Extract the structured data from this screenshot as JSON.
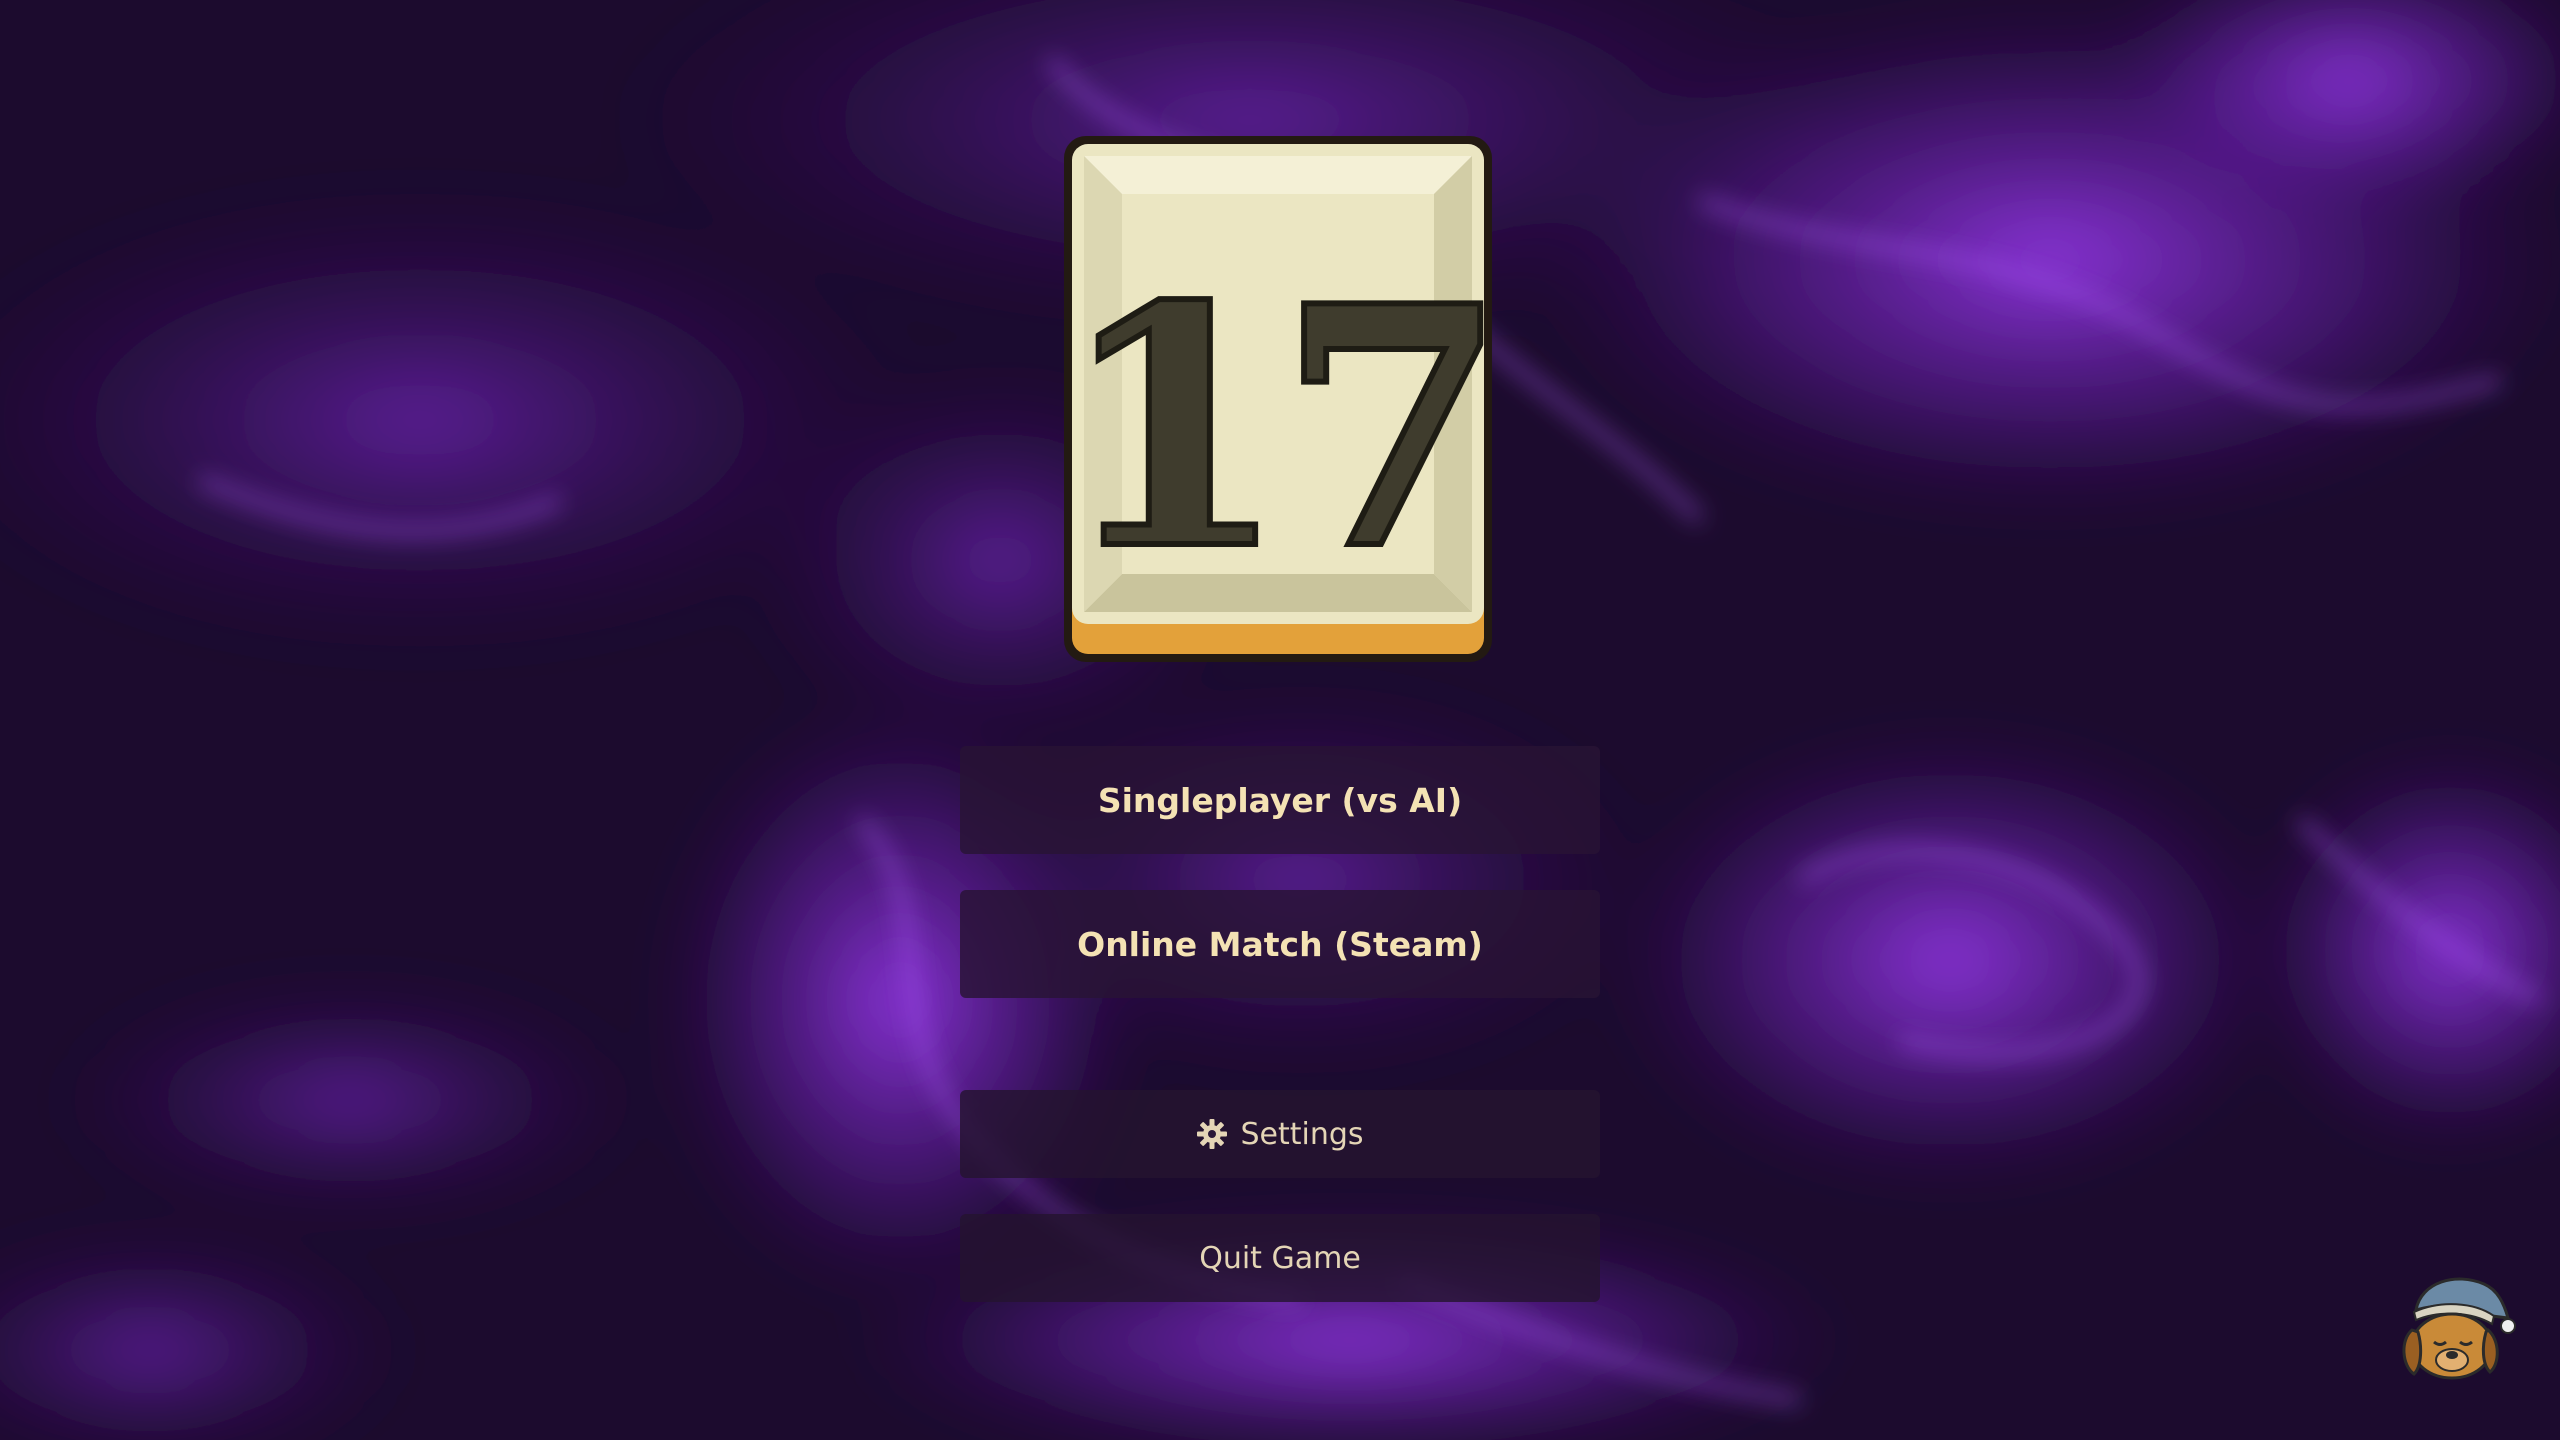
{
  "logo": {
    "number": "17",
    "tile_face_color": "#ebe6c2",
    "tile_edge_color": "#e3a13a",
    "digit_color": "#3f3c2d"
  },
  "menu": {
    "singleplayer_label": "Singleplayer (vs AI)",
    "online_label": "Online Match (Steam)",
    "settings_label": "Settings",
    "settings_icon": "gear-icon",
    "quit_label": "Quit Game"
  },
  "mascot": {
    "icon": "sleepy-dog-icon"
  },
  "colors": {
    "background_dark": "#1a0a2a",
    "background_purple": "#8a2bd4",
    "button_bg": "#28143a",
    "button_text": "#f0dfb4"
  }
}
